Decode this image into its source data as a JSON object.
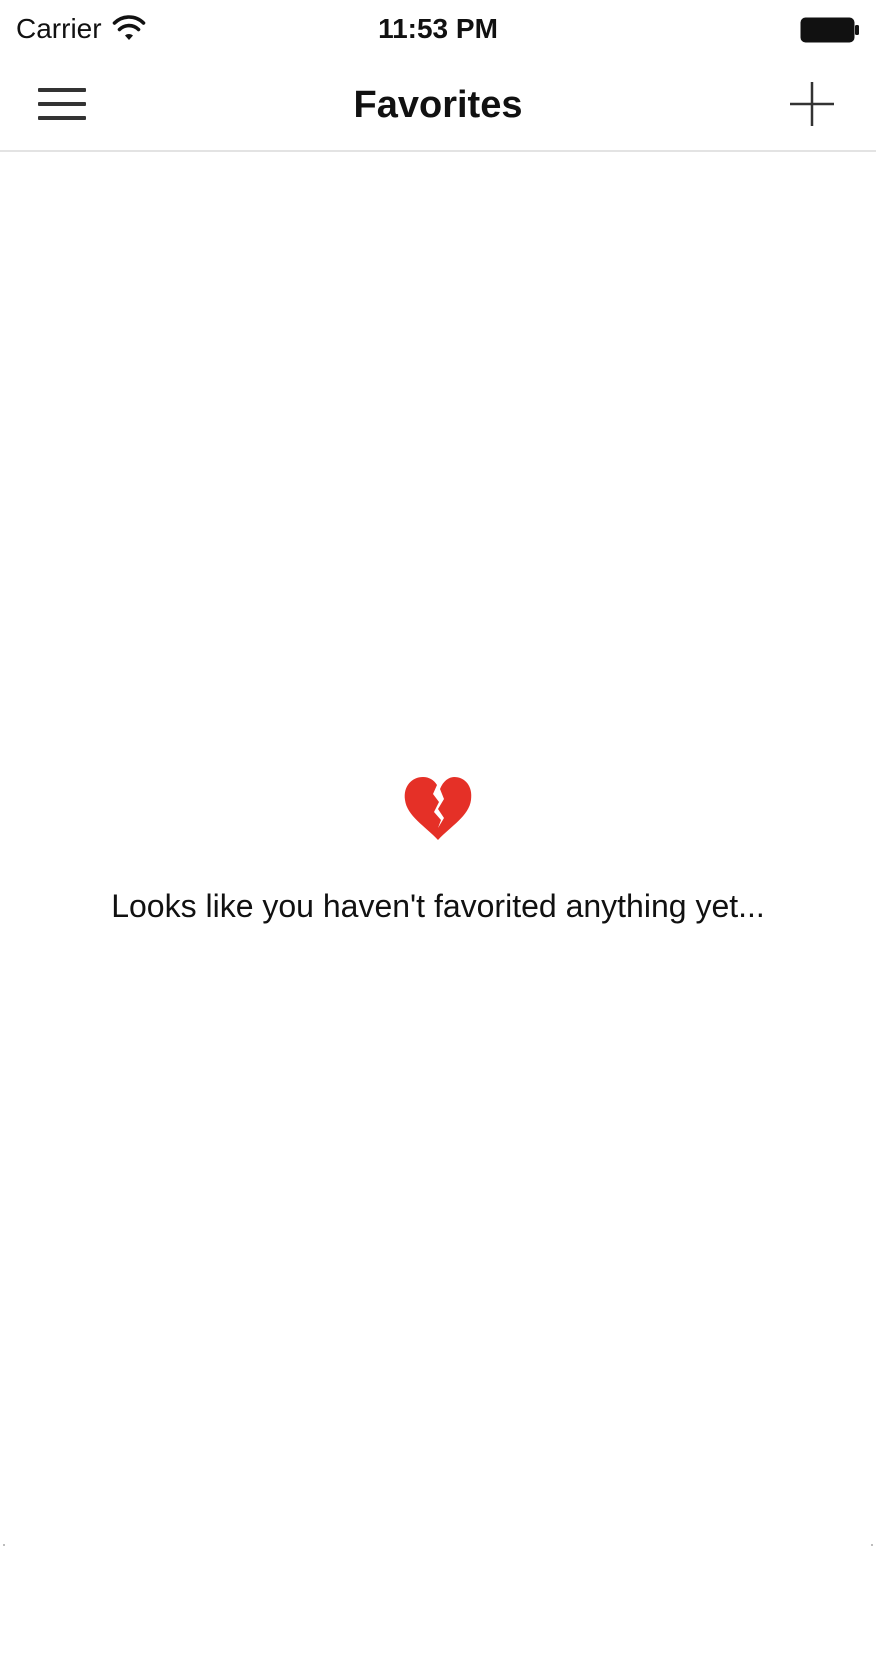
{
  "status_bar": {
    "carrier": "Carrier",
    "time": "11:53 PM",
    "wifi_icon": "wifi-icon",
    "battery_icon": "battery-full-icon"
  },
  "nav_bar": {
    "title": "Favorites",
    "menu_icon": "hamburger-menu-icon",
    "add_icon": "plus-icon"
  },
  "empty_state": {
    "icon": "broken-heart-icon",
    "icon_color": "#e53027",
    "message": "Looks like you haven't favorited anything yet..."
  },
  "colors": {
    "background": "#ffffff",
    "text": "#111111",
    "divider": "#e3e3e3",
    "accent": "#e53027"
  }
}
